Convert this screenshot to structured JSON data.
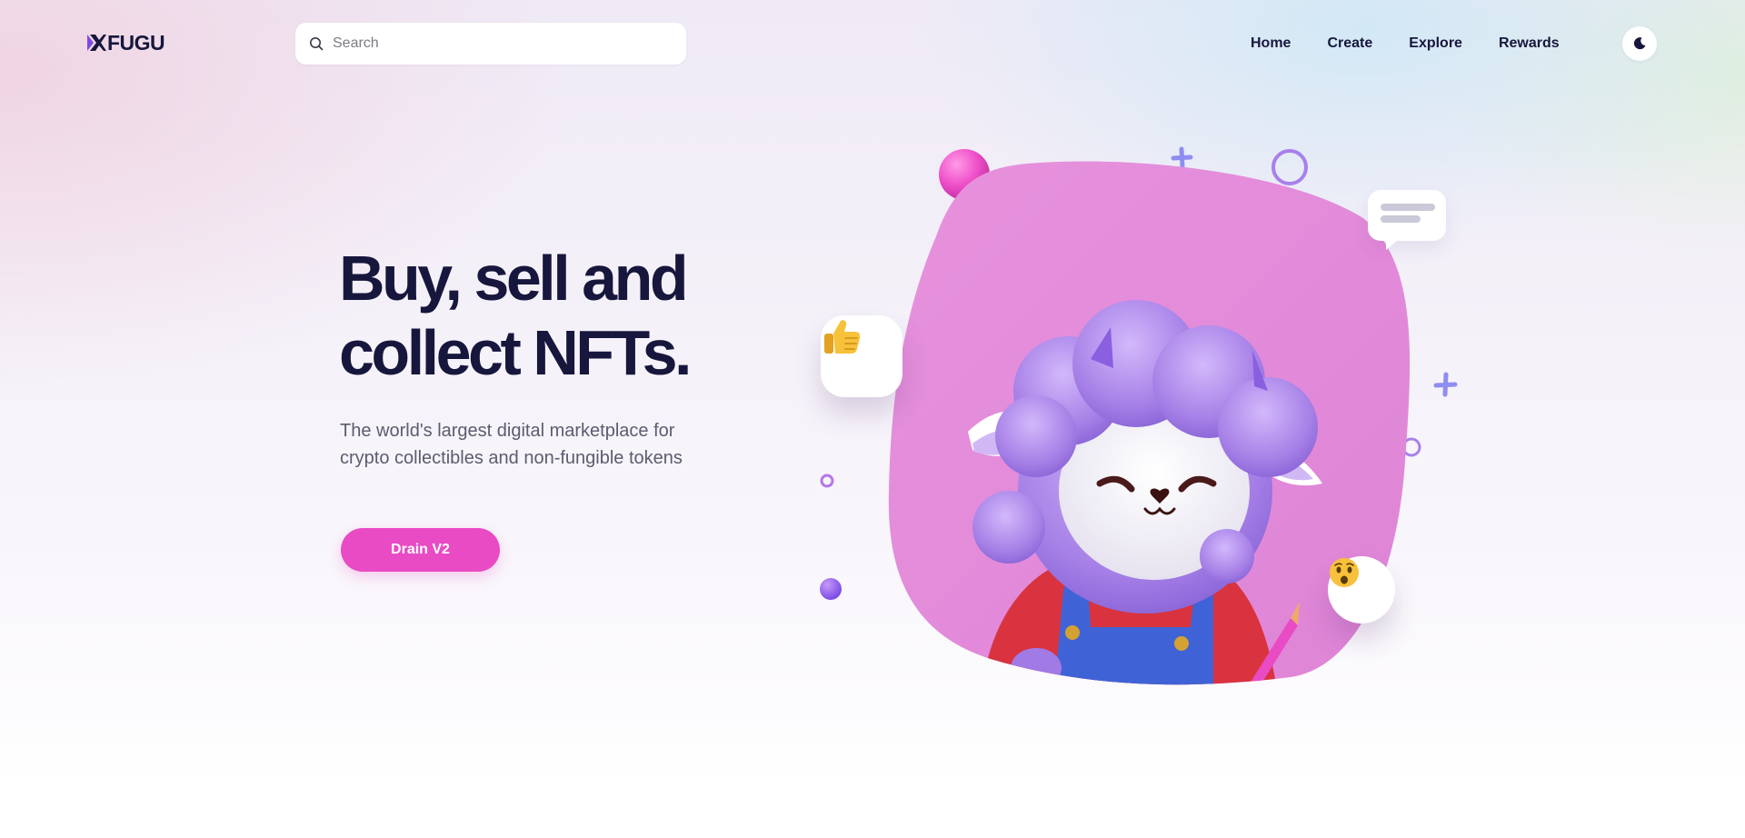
{
  "header": {
    "logo_text": "FUGU",
    "search_placeholder": "Search",
    "nav": [
      {
        "label": "Home"
      },
      {
        "label": "Create"
      },
      {
        "label": "Explore"
      },
      {
        "label": "Rewards"
      }
    ],
    "theme_toggle_icon": "moon-icon"
  },
  "hero": {
    "title_line1": "Buy, sell and",
    "title_line2": "collect NFTs.",
    "subtitle": "The world's largest digital marketplace for crypto collectibles and non-fungible tokens",
    "cta_label": "Drain V2"
  },
  "illustration": {
    "subject": "purple sheep character in red shirt and blue overalls",
    "card_icon": "thumbs-up-icon",
    "bubble_icon": "surprised-face-icon",
    "chat_icon": "chat-bubble-icon"
  },
  "colors": {
    "brand_text": "#17173d",
    "accent": "#e94bc4",
    "blob": "#e38fdb",
    "wool": "#a57fe6"
  }
}
